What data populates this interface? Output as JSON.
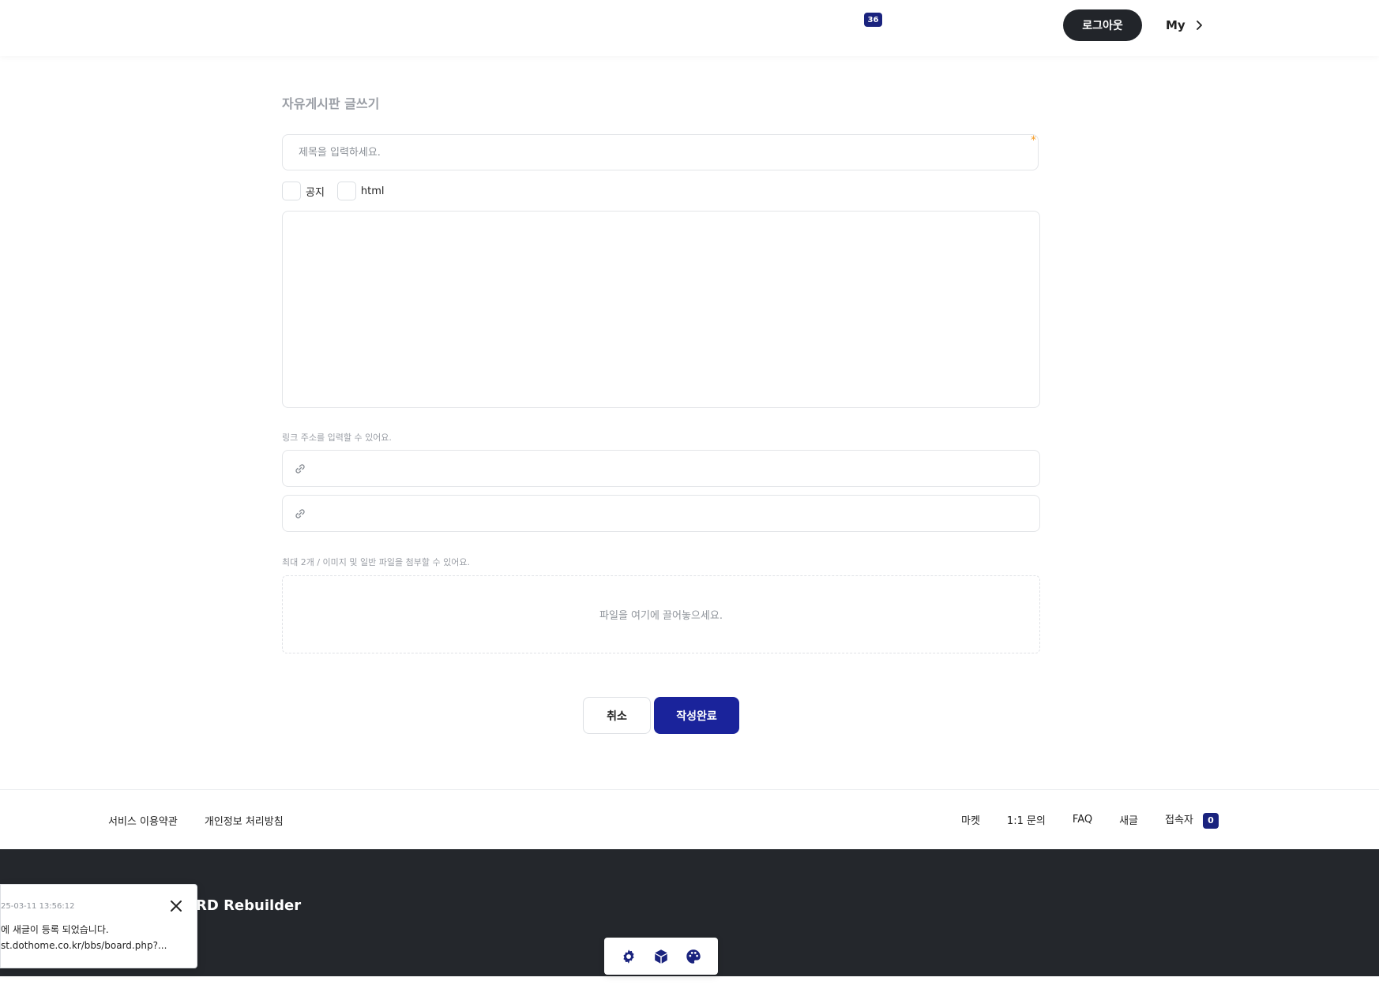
{
  "header": {
    "notification_count": "36",
    "logout_label": "로그아웃",
    "my_label": "My"
  },
  "form": {
    "page_title": "자유게시판 글쓰기",
    "title_placeholder": "제목을 입력하세요.",
    "required_mark": "*",
    "checkbox_notice_label": "공지",
    "checkbox_html_label": "html",
    "link_hint": "링크 주소를 입력할 수 있어요.",
    "file_hint": "최대 2개 / 이미지 및 일반 파일을 첨부할 수 있어요.",
    "dropzone_text": "파일을 여기에 끌어놓으세요.",
    "cancel_label": "취소",
    "submit_label": "작성완료"
  },
  "footer": {
    "left_links": [
      "서비스 이용약관",
      "개인정보 처리방침"
    ],
    "right_links": [
      "마켓",
      "1:1 문의",
      "FAQ",
      "새글",
      "접속자"
    ],
    "visitor_count": "0",
    "brand": "RD Rebuilder"
  },
  "toast": {
    "time": "25-03-11 13:56:12",
    "message_line1": "에 새글이 등록 되었습니다.",
    "message_line2": "st.dothome.co.kr/bbs/board.php?..."
  },
  "toolbar": {
    "icons": [
      "gear-icon",
      "cube-icon",
      "palette-icon"
    ]
  },
  "colors": {
    "accent": "#1a239b",
    "dark": "#24272c",
    "required": "#f59a23"
  }
}
